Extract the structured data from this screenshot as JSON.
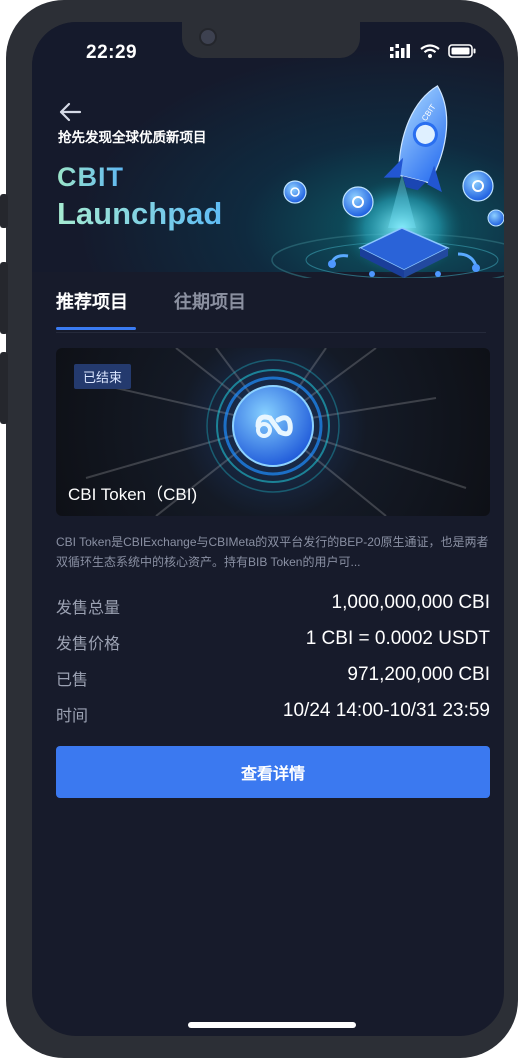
{
  "status_bar": {
    "time": "22:29"
  },
  "hero": {
    "subtitle": "抢先发现全球优质新项目",
    "brand_line1": "CBIT",
    "brand_line2": "Launchpad",
    "rocket_label": "CBIT"
  },
  "tabs": [
    {
      "label": "推荐项目",
      "active": true
    },
    {
      "label": "往期项目",
      "active": false
    }
  ],
  "project": {
    "badge": "已结束",
    "title": "CBI Token（CBI)",
    "description": "CBI Token是CBIExchange与CBIMeta的双平台发行的BEP-20原生通证，也是两者双循环生态系统中的核心资产。持有BIB Token的用户可...",
    "details": [
      {
        "label": "发售总量",
        "value": "1,000,000,000 CBI"
      },
      {
        "label": "发售价格",
        "value": "1 CBI = 0.0002 USDT"
      },
      {
        "label": "已售",
        "value": "971,200,000 CBI"
      },
      {
        "label": "时间",
        "value": "10/24 14:00-10/31 23:59"
      }
    ],
    "button_label": "查看详情"
  },
  "colors": {
    "background": "#171b2b",
    "accent": "#3b79f0",
    "badge_bg": "#243a6e",
    "brand_gradient_start": "#9ce5c9",
    "brand_gradient_end": "#5fb8f4"
  }
}
